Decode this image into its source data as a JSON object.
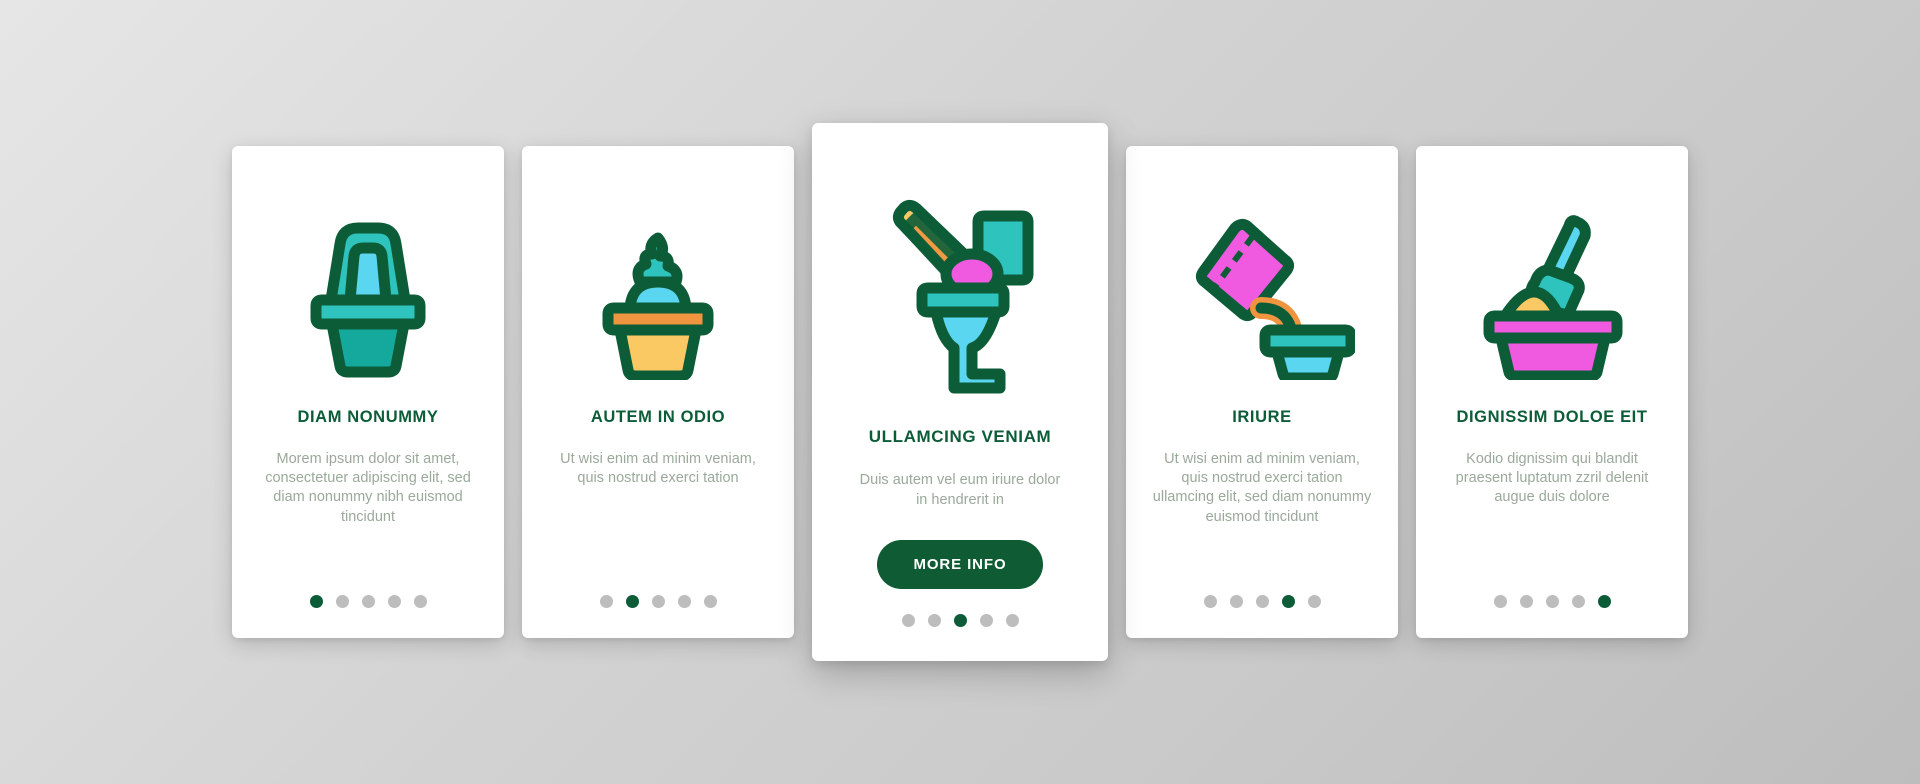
{
  "palette": {
    "background": "#d4d4d4",
    "card_bg": "#ffffff",
    "title_green": "#0d5c38",
    "body_gray": "#9aa99a",
    "button_green": "#0f5b33",
    "dot_inactive": "#bdbdbd",
    "dot_active": "#0d5c38",
    "icon_outline": "#0d5c38",
    "icon_teal": "#2ec4bd",
    "icon_cyan": "#5ad6f0",
    "icon_deep_teal": "#15a99e",
    "icon_orange": "#f0953f",
    "icon_yellow": "#fbc963",
    "icon_magenta": "#ef5ae0"
  },
  "cards": [
    {
      "id": "card-diam-nonummy",
      "icon": "litter-box-icon",
      "title": "DIAM NONUMMY",
      "body": "Morem ipsum dolor sit amet, consectetuer adipiscing elit, sed diam nonummy nibh euismod tincidunt",
      "featured": false,
      "dots": {
        "count": 5,
        "active_index": 0
      }
    },
    {
      "id": "card-autem-in-odio",
      "icon": "litter-scoop-pile-icon",
      "title": "AUTEM IN ODIO",
      "body": "Ut wisi enim ad minim veniam, quis nostrud exerci tation",
      "featured": false,
      "dots": {
        "count": 5,
        "active_index": 1
      }
    },
    {
      "id": "card-ullamcing-veniam",
      "icon": "toilet-brush-icon",
      "title": "ULLAMCING VENIAM",
      "body": "Duis autem vel eum iriure dolor in hendrerit in",
      "button_label": "MORE INFO",
      "featured": true,
      "dots": {
        "count": 5,
        "active_index": 2
      }
    },
    {
      "id": "card-iriure",
      "icon": "pouring-bag-tray-icon",
      "title": "IRIURE",
      "body": "Ut wisi enim ad minim veniam, quis nostrud exerci tation ullamcing elit, sed diam nonummy euismod tincidunt",
      "featured": false,
      "dots": {
        "count": 5,
        "active_index": 3
      }
    },
    {
      "id": "card-dignissim-doloe-eit",
      "icon": "scoop-in-tray-icon",
      "title": "DIGNISSIM DOLOE EIT",
      "body": "Kodio dignissim qui blandit praesent luptatum zzril delenit augue duis dolore",
      "featured": false,
      "dots": {
        "count": 5,
        "active_index": 4
      }
    }
  ]
}
